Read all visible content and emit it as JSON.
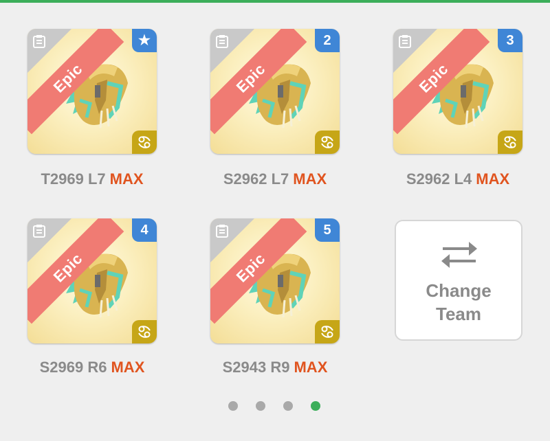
{
  "cards": [
    {
      "badge": "★",
      "ribbon": "Epic",
      "code": "T2969 L7",
      "max": "MAX"
    },
    {
      "badge": "2",
      "ribbon": "Epic",
      "code": "S2962 L7",
      "max": "MAX"
    },
    {
      "badge": "3",
      "ribbon": "Epic",
      "code": "S2962 L4",
      "max": "MAX"
    },
    {
      "badge": "4",
      "ribbon": "Epic",
      "code": "S2969 R6",
      "max": "MAX"
    },
    {
      "badge": "5",
      "ribbon": "Epic",
      "code": "S2943 R9",
      "max": "MAX"
    }
  ],
  "change_team": {
    "line1": "Change",
    "line2": "Team",
    "icon": "swap-arrows-icon"
  },
  "pagination": {
    "total": 4,
    "active": 4
  },
  "colors": {
    "accent": "#3cae5a",
    "ribbon": "#f07b73",
    "badge": "#3f86d6",
    "sign": "#c6a617",
    "max": "#e0541f"
  }
}
